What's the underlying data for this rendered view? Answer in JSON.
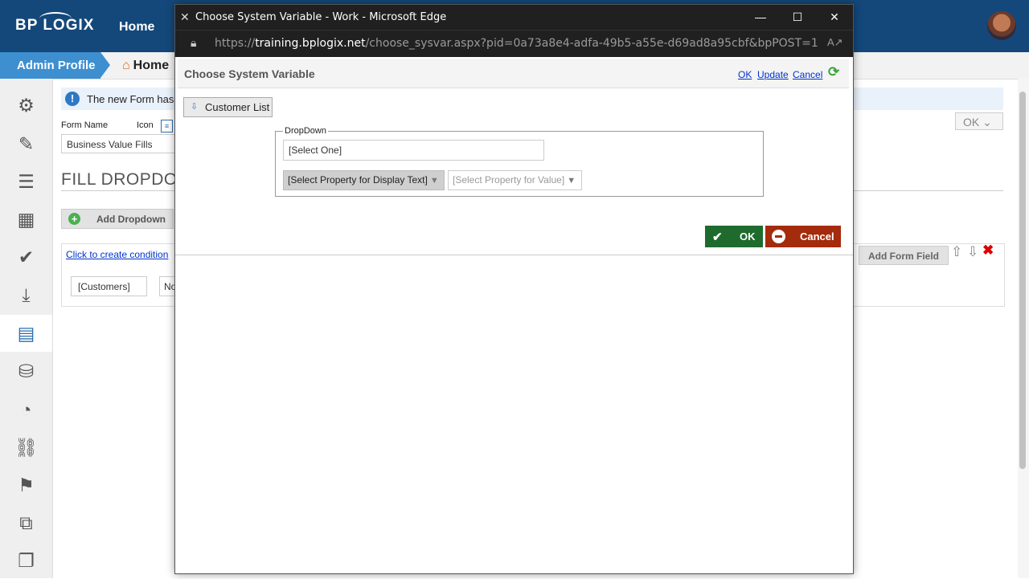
{
  "app": {
    "logo": "BP LOGIX",
    "top_nav_home": "Home",
    "breadcrumb_admin": "Admin Profile",
    "breadcrumb_home": "Home",
    "info_text": "The new Form has b",
    "form_name_label": "Form Name",
    "icon_label": "Icon",
    "form_name_value": "Business Value Fills",
    "page_title": "FILL DROPDOW",
    "add_dropdown_label": "Add Dropdown",
    "condition_link": "Click to create condition",
    "customers_field": "[Customers]",
    "no_field": "No",
    "ok_label": "OK",
    "add_form_field_label": "Add Form Field"
  },
  "browser_window": {
    "title": "Choose System Variable - Work - Microsoft Edge",
    "url_prefix": "https://",
    "url_host": "training.bplogix.net",
    "url_path": "/choose_sysvar.aspx?pid=0a73a8e4-adfa-49b5-a55e-d69ad8a95cbf&bpPOST=1"
  },
  "dialog": {
    "title": "Choose System Variable",
    "links": [
      "OK",
      "Update",
      "Cancel"
    ],
    "customer_list_button": "Customer List",
    "fieldset_legend": "DropDown",
    "select_one_value": "[Select One]",
    "display_property": "[Select Property for Display Text]",
    "value_property": "[Select Property for Value]",
    "ok_button": "OK",
    "cancel_button": "Cancel"
  },
  "colors": {
    "topbar": "#14487a",
    "breadcrumb_accent": "#3d8fd0",
    "ok_green": "#1e6b2d",
    "cancel_red": "#a42b0c",
    "link_blue": "#0033cc"
  },
  "icons": {
    "sidebar": [
      "gears-icon",
      "edit-icon",
      "list-icon",
      "table-icon",
      "check-icon",
      "import-icon",
      "form-icon",
      "database-add-icon",
      "dashboard-icon",
      "link-icon",
      "flag-icon",
      "hierarchy-icon",
      "copy-icon"
    ]
  }
}
